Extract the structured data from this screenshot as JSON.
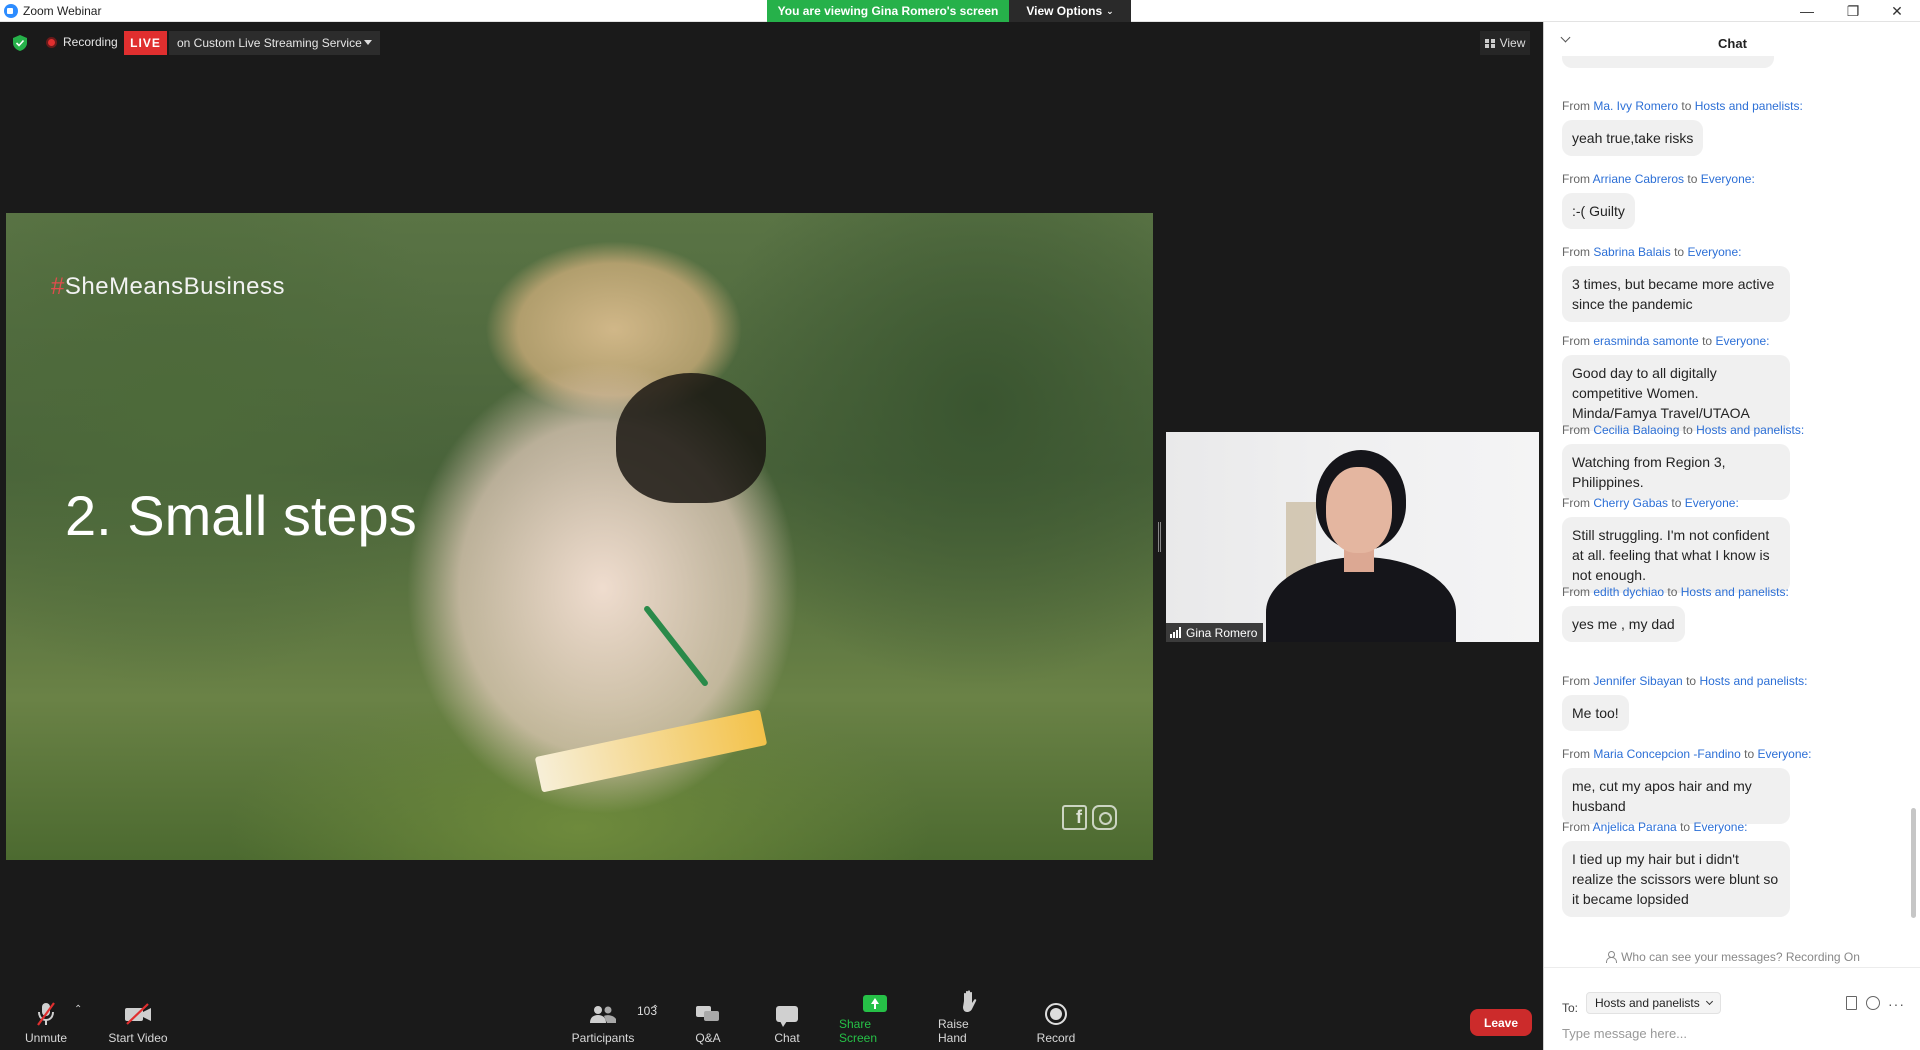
{
  "titlebar": {
    "title": "Zoom Webinar",
    "banner": "You are viewing Gina Romero's screen",
    "view_options": "View Options"
  },
  "stage": {
    "recording_label": "Recording",
    "live_badge": "LIVE",
    "stream_service": "on Custom Live Streaming Service",
    "view_label": "View"
  },
  "slide": {
    "hashtag_symbol": "#",
    "hashtag_text": "SheMeansBusiness",
    "heading": "2. Small steps"
  },
  "speaker": {
    "name": "Gina Romero"
  },
  "toolbar": {
    "unmute": "Unmute",
    "start_video": "Start Video",
    "participants": "Participants",
    "participants_count": "103",
    "qa": "Q&A",
    "chat": "Chat",
    "share_screen": "Share Screen",
    "raise_hand": "Raise Hand",
    "record": "Record",
    "leave": "Leave",
    "share_color": "#26c047",
    "leave_color": "#cc2b2b"
  },
  "chat": {
    "title": "Chat",
    "from_word": "From",
    "to_word": "to",
    "messages": [
      {
        "sender": "Ma. Ivy Romero",
        "recipient": "Hosts and panelists:",
        "text": "yeah true,take risks"
      },
      {
        "sender": "Arriane Cabreros",
        "recipient": "Everyone:",
        "text": ":-( Guilty"
      },
      {
        "sender": "Sabrina Balais",
        "recipient": "Everyone:",
        "text": "3 times, but became more active since the pandemic"
      },
      {
        "sender": "erasminda samonte",
        "recipient": "Everyone:",
        "text": "Good day to all digitally competitive Women.  Minda/Famya Travel/UTAOA"
      },
      {
        "sender": "Cecilia Balaoing",
        "recipient": "Hosts and panelists:",
        "text": "Watching from Region 3, Philippines."
      },
      {
        "sender": "Cherry Gabas",
        "recipient": "Everyone:",
        "text": "Still struggling. I'm not confident at all. feeling that what I know is not enough."
      },
      {
        "sender": "edith dychiao",
        "recipient": "Hosts and panelists:",
        "text": "yes me , my dad"
      },
      {
        "sender": "Jennifer Sibayan",
        "recipient": "Hosts and panelists:",
        "text": "Me too!"
      },
      {
        "sender": "Maria Concepcion -Fandino",
        "recipient": "Everyone:",
        "text": "me, cut my apos hair and my husband"
      },
      {
        "sender": "Anjelica Parana",
        "recipient": "Everyone:",
        "text": "I tied up my hair but i didn't realize the scissors were blunt so it became lopsided"
      }
    ],
    "visibility_note": "Who can see your messages? Recording On",
    "to_label": "To:",
    "to_value": "Hosts and panelists",
    "input_placeholder": "Type message here...",
    "link_color": "#2c6fd6"
  }
}
